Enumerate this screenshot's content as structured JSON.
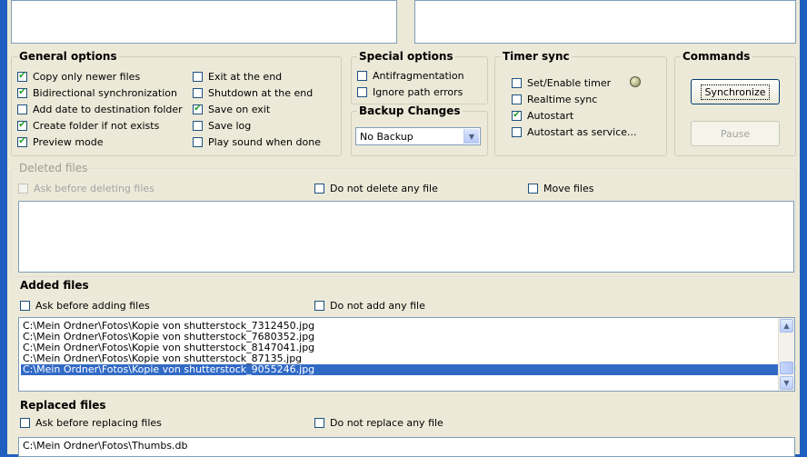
{
  "general_options": {
    "title": "General options",
    "left": [
      {
        "label": "Copy only newer files",
        "checked": true
      },
      {
        "label": "Bidirectional synchronization",
        "checked": true
      },
      {
        "label": "Add date to destination folder",
        "checked": false
      },
      {
        "label": "Create folder if not exists",
        "checked": true
      },
      {
        "label": "Preview mode",
        "checked": true
      }
    ],
    "right": [
      {
        "label": "Exit at the end",
        "checked": false
      },
      {
        "label": "Shutdown at the end",
        "checked": false
      },
      {
        "label": "Save on exit",
        "checked": true
      },
      {
        "label": "Save log",
        "checked": false
      },
      {
        "label": "Play sound when done",
        "checked": false
      }
    ]
  },
  "special_options": {
    "title": "Special options",
    "items": [
      {
        "label": "Antifragmentation",
        "checked": false
      },
      {
        "label": "Ignore path errors",
        "checked": false
      }
    ]
  },
  "backup_changes": {
    "title": "Backup Changes",
    "value": "No Backup"
  },
  "timer_sync": {
    "title": "Timer sync",
    "items": [
      {
        "label": "Set/Enable timer",
        "checked": false
      },
      {
        "label": "Realtime sync",
        "checked": false
      },
      {
        "label": "Autostart",
        "checked": true
      },
      {
        "label": "Autostart as service...",
        "checked": false
      }
    ]
  },
  "commands": {
    "title": "Commands",
    "synchronize": "Synchronize",
    "pause": "Pause"
  },
  "deleted_files": {
    "title": "Deleted files",
    "ask": "Ask before deleting files",
    "no_action": "Do not delete any file",
    "move": "Move files"
  },
  "added_files": {
    "title": "Added files",
    "ask": "Ask before adding files",
    "no_action": "Do not add any file",
    "rows": [
      "C:\\Mein Ordner\\Fotos\\Kopie von shutterstock_7312450.jpg",
      "C:\\Mein Ordner\\Fotos\\Kopie von shutterstock_7680352.jpg",
      "C:\\Mein Ordner\\Fotos\\Kopie von shutterstock_8147041.jpg",
      "C:\\Mein Ordner\\Fotos\\Kopie von shutterstock_87135.jpg",
      "C:\\Mein Ordner\\Fotos\\Kopie von shutterstock_9055246.jpg"
    ],
    "selected_index": 4
  },
  "replaced_files": {
    "title": "Replaced files",
    "ask": "Ask before replacing files",
    "no_action": "Do not replace any file",
    "rows": [
      "C:\\Mein Ordner\\Fotos\\Thumbs.db"
    ]
  },
  "check_mark": "✔",
  "colors": {
    "window_frame": "#1f5fbf",
    "face": "#ece9d8",
    "selection": "#316ac5",
    "check": "#21a121"
  }
}
